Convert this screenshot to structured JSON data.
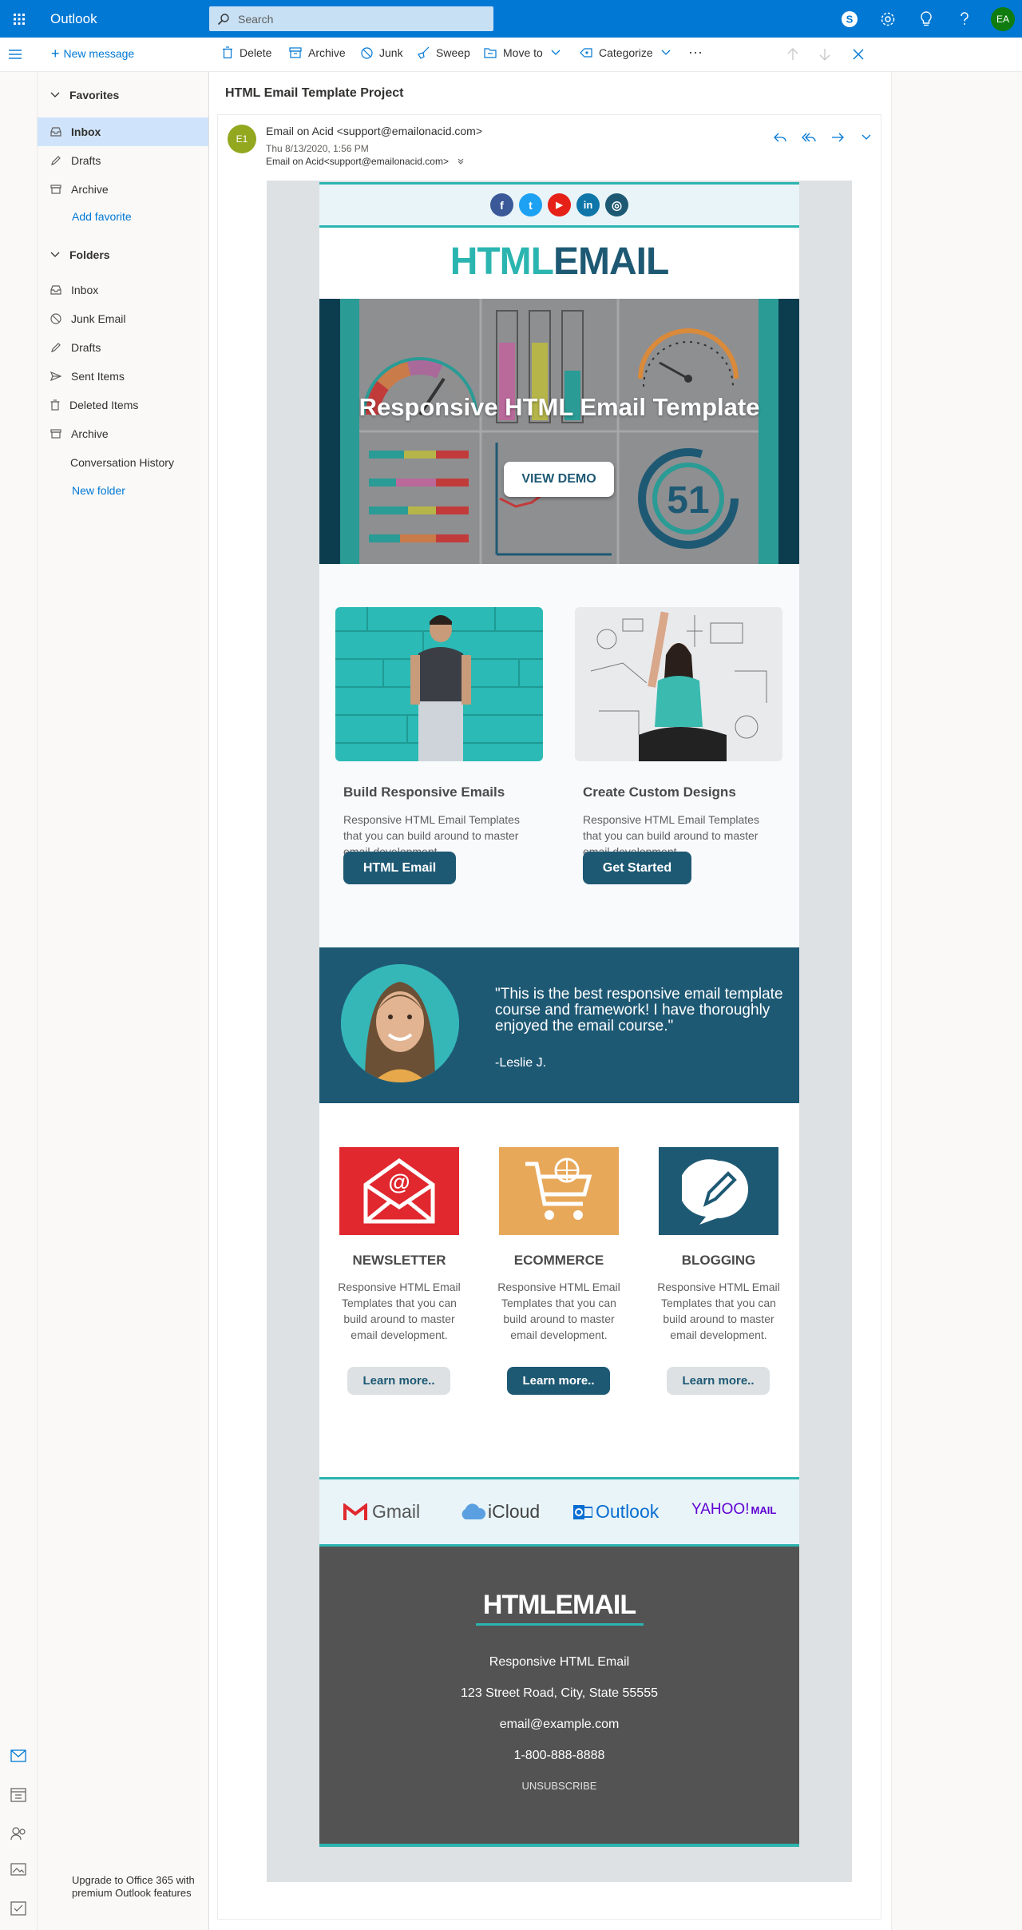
{
  "app": {
    "name": "Outlook",
    "accent": "#0078d4",
    "user_initials": "EA"
  },
  "search": {
    "placeholder": "Search"
  },
  "topbar_icons": [
    "skype-icon",
    "gear-icon",
    "lightbulb-icon",
    "help-icon"
  ],
  "commands": {
    "new_message": "New message",
    "delete": "Delete",
    "archive": "Archive",
    "junk": "Junk",
    "sweep": "Sweep",
    "move_to": "Move to",
    "categorize": "Categorize"
  },
  "favorites": {
    "heading": "Favorites",
    "items": [
      {
        "label": "Inbox",
        "icon": "inbox-icon",
        "selected": true
      },
      {
        "label": "Drafts",
        "icon": "pencil-icon"
      },
      {
        "label": "Archive",
        "icon": "archive-icon"
      }
    ],
    "add_link": "Add favorite"
  },
  "folders": {
    "heading": "Folders",
    "items": [
      {
        "label": "Inbox",
        "icon": "inbox-icon"
      },
      {
        "label": "Junk Email",
        "icon": "block-icon"
      },
      {
        "label": "Drafts",
        "icon": "pencil-icon"
      },
      {
        "label": "Sent Items",
        "icon": "send-icon"
      },
      {
        "label": "Deleted Items",
        "icon": "trash-icon"
      },
      {
        "label": "Archive",
        "icon": "archive-icon"
      },
      {
        "label": "Conversation History",
        "icon": ""
      }
    ],
    "new_folder_link": "New folder"
  },
  "upgrade": "Upgrade to Office 365 with premium Outlook features",
  "message": {
    "subject": "HTML Email Template Project",
    "sender_initials": "E1",
    "sender": "Email on Acid <support@emailonacid.com>",
    "date": "Thu 8/13/2020, 1:56 PM",
    "to": "Email on Acid<support@emailonacid.com>"
  },
  "email": {
    "logo_part1": "HTML",
    "logo_part2": "EMAIL",
    "social": [
      "f",
      "t",
      "▶",
      "in",
      "◎"
    ],
    "hero_title": "Responsive HTML Email Template",
    "hero_button": "VIEW DEMO",
    "hero_number": "51",
    "features": [
      {
        "title": "Build Responsive Emails",
        "text": "Responsive HTML Email Templates that you can build around to master email development.",
        "button": "HTML Email"
      },
      {
        "title": "Create Custom Designs",
        "text": "Responsive HTML Email Templates that you can build around to master email development.",
        "button": "Get Started"
      }
    ],
    "testimonial": {
      "quote": "\"This is the best responsive email template course and framework! I have thoroughly enjoyed the email course.\"",
      "author": "-Leslie J."
    },
    "services": [
      {
        "title": "NEWSLETTER",
        "text": "Responsive HTML Email Templates that you can build around to master email development.",
        "button": "Learn more..",
        "color": "#e0282e"
      },
      {
        "title": "ECOMMERCE",
        "text": "Responsive HTML Email Templates that you can build around to master email development.",
        "button": "Learn more..",
        "color": "#e8a85a"
      },
      {
        "title": "BLOGGING",
        "text": "Responsive HTML Email Templates that you can build around to master email development.",
        "button": "Learn more..",
        "color": "#1e5974"
      }
    ],
    "providers": [
      "Gmail",
      "iCloud",
      "Outlook",
      "YAHOO!",
      "MAIL"
    ],
    "footer": {
      "logo": "HTMLEMAIL",
      "company": "Responsive HTML Email",
      "address": "123 Street Road, City, State 55555",
      "email": "email@example.com",
      "phone": "1-800-888-8888",
      "unsubscribe": "UNSUBSCRIBE"
    },
    "colors": {
      "teal": "#2bb5b0",
      "navy": "#1e5974",
      "footer_bg": "#535353"
    }
  }
}
